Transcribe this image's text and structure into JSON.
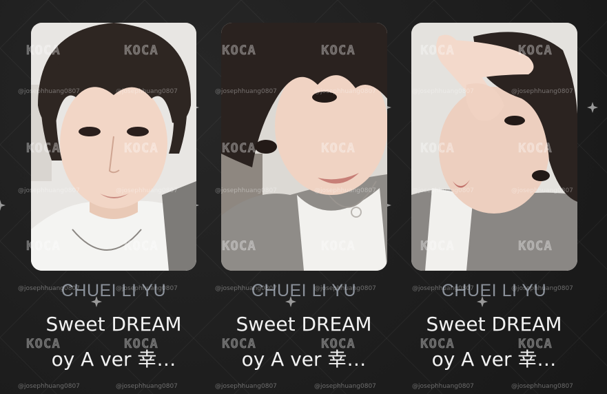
{
  "cards": [
    {
      "member": "CHUEI LI YU",
      "title_line1": "Sweet DREAM",
      "title_line2": "oy A ver 幸…"
    },
    {
      "member": "CHUEI LI YU",
      "title_line1": "Sweet DREAM",
      "title_line2": "oy A ver 幸…"
    },
    {
      "member": "CHUEI LI YU",
      "title_line1": "Sweet DREAM",
      "title_line2": "oy A ver 幸…"
    }
  ],
  "watermark": {
    "logo": "KOCA",
    "handle": "@josephhuang0807"
  },
  "colors": {
    "background": "#1f1f1f",
    "member_text": "#8a9099",
    "title_text": "#f2f2f2"
  }
}
